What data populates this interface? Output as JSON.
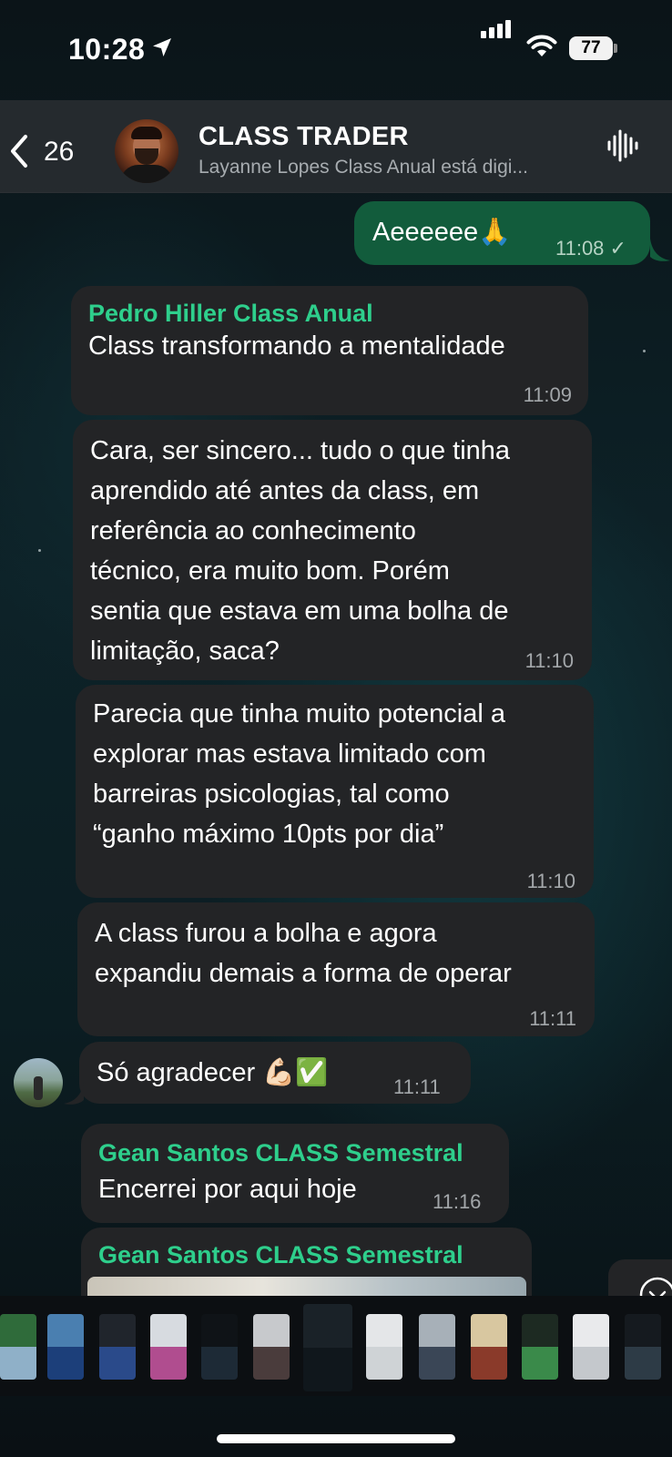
{
  "status_bar": {
    "time": "10:28",
    "battery": "77"
  },
  "header": {
    "back_count": "26",
    "title": "CLASS TRADER",
    "subtitle": "Layanne Lopes Class Anual está digi..."
  },
  "messages": [
    {
      "direction": "out",
      "text": "Aeeeeee🙏",
      "time": "11:08 ✓"
    },
    {
      "direction": "in",
      "sender": "Pedro Hiller Class Anual",
      "text": "Class transformando a mentalidade",
      "time": "11:09"
    },
    {
      "direction": "in",
      "text": "Cara, ser sincero... tudo o que tinha\naprendido até antes da class, em\nreferência ao conhecimento\ntécnico, era muito bom. Porém\nsentia que estava em uma bolha de\nlimitação, saca?",
      "time": "11:10"
    },
    {
      "direction": "in",
      "text": "Parecia que tinha muito potencial a\nexplorar mas estava limitado com\nbarreiras psicologias, tal como\n“ganho máximo 10pts por dia”",
      "time": "11:10"
    },
    {
      "direction": "in",
      "text": "A class furou a bolha e agora\nexpandiu demais a forma de operar",
      "time": "11:11"
    },
    {
      "direction": "in",
      "text": "Só agradecer 💪🏻✅",
      "time": "11:11"
    },
    {
      "direction": "in",
      "sender": "Gean Santos CLASS Semestral",
      "text": "Encerrei por aqui hoje",
      "time": "11:16"
    },
    {
      "direction": "in",
      "sender": "Gean Santos CLASS Semestral",
      "text": ""
    }
  ],
  "colors": {
    "accent_sender": "#2ecf8c",
    "bubble_in": "#232426",
    "bubble_out": "#125c3c",
    "header_bg": "#282c30"
  },
  "icons": {
    "back": "chevron-left-icon",
    "voice": "voice-waveform-icon",
    "scroll": "chevron-down-icon",
    "location": "location-arrow-icon",
    "wifi": "wifi-icon",
    "signal": "cellular-signal-icon"
  }
}
